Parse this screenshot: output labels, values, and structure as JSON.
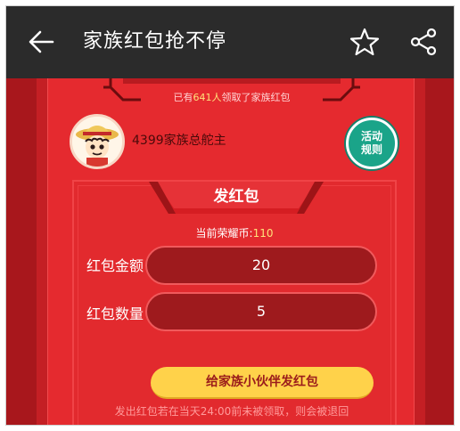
{
  "header": {
    "title": "家族红包抢不停"
  },
  "banner": {
    "prefix": "已有",
    "count": "641人",
    "suffix": "领取了家族红包"
  },
  "owner": {
    "name": "4399家族总舵主"
  },
  "rules_button": {
    "line1": "活动",
    "line2": "规则"
  },
  "panel": {
    "title": "发红包",
    "coins_label": "当前荣耀币:",
    "coins_value": "110",
    "amount_label": "红包金额",
    "amount_value": "20",
    "quantity_label": "红包数量",
    "quantity_value": "5",
    "send_label": "给家族小伙伴发红包"
  },
  "notice": "发出红包若在当天24:00前未被领取，则会被退回",
  "colors": {
    "appbar": "#2b2b2b",
    "background": "#c41f24",
    "card": "#e52a2f",
    "field": "#9e1a1d",
    "accent_yellow": "#ffd24a",
    "rules_green": "#1aa489"
  },
  "icons": [
    "back-arrow-icon",
    "star-icon",
    "share-icon",
    "avatar"
  ]
}
